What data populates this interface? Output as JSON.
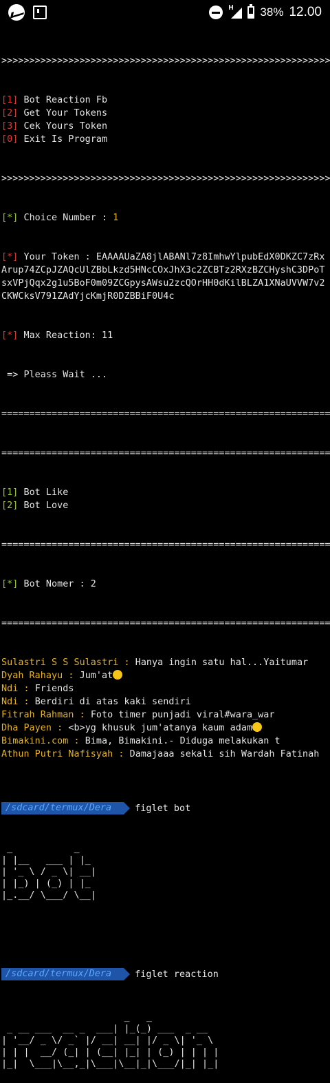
{
  "status_bar": {
    "battery": "38%",
    "time": "12.00",
    "icons": [
      "messenger-icon",
      "flipboard-icon",
      "do-not-disturb-icon",
      "signal-h-icon",
      "battery-icon"
    ]
  },
  "terminal": {
    "sep_arrows": ">>>>>>>>>>>>>>>>>>>>>>>>>>>>>>>>>>>>>>>>>>>>>>>>>>>>>>>>>>>>>>>>>>>>>>>>>>>>>>>>>>>>>",
    "sep_equals": "========================================================================================",
    "menu": [
      {
        "num": "[1]",
        "label": " Bot Reaction Fb"
      },
      {
        "num": "[2]",
        "label": " Get Your Tokens"
      },
      {
        "num": "[3]",
        "label": " Cek Yours Token"
      },
      {
        "num": "[0]",
        "label": " Exit Is Program"
      }
    ],
    "choice": {
      "tag": "[*]",
      "label": " Choice Number : ",
      "value": "1"
    },
    "token": {
      "tag": "[*]",
      "label": " Your Token : ",
      "value": "EAAAAUaZA8jlABANl7z8ImhwYlpubEdX0DKZC7zRxArup74ZCpJZAQcUlZBbLkzd5HNcCOxJhX3c2ZCBTz2RXzBZCHyshC3DPoTsxVPjQqx2g1u5BoF0m09ZCGpysAWsu2zcQOrHH0dKilBLZA1XNaUVVW7v2CKWCksV791ZAdYjcKmjR0DZBBiF0U4c"
    },
    "max_reaction": {
      "tag": "[*]",
      "label": " Max Reaction: 11"
    },
    "wait": " => Pleass Wait ...",
    "bot_options": [
      {
        "num": "[1]",
        "label": " Bot Like"
      },
      {
        "num": "[2]",
        "label": " Bot Love"
      }
    ],
    "bot_nomer": {
      "tag": "[*]",
      "label": " Bot Nomer : 2"
    },
    "feed": [
      {
        "name": "Sulastri S S Sulastri",
        "sep": " : ",
        "text": "Hanya ingin satu hal...Yaitumar",
        "emoji": false
      },
      {
        "name": "Dyah Rahayu",
        "sep": " : ",
        "text": "Jum'at",
        "emoji": true
      },
      {
        "name": "Ndi",
        "sep": " : ",
        "text": "Friends",
        "emoji": false
      },
      {
        "name": "Ndi",
        "sep": " : ",
        "text": "Berdiri di atas kaki sendiri",
        "emoji": false
      },
      {
        "name": "Fitrah Rahman",
        "sep": " : ",
        "text": "Foto timer punjadi viral#wara_war",
        "emoji": false
      },
      {
        "name": "Dha Payen",
        "sep": " : ",
        "text": "<b>yg khusuk jum'atanya kaum adam",
        "emoji": true
      },
      {
        "name": "Bimakini.com",
        "sep": " : ",
        "text": "Bima, Bimakini.- Diduga melakukan t",
        "emoji": false
      },
      {
        "name": "Athun Putri Nafisyah",
        "sep": " : ",
        "text": "Damajaaa sekali sih Wardah Fatinah",
        "emoji": false
      }
    ],
    "prompt_path": "/sdcard/termux/Dera",
    "cmd1": "figlet bot",
    "art_bot": " _           _   \n| |__   ___ | |_ \n| '_ \\ / _ \\| __|\n| |_) | (_) | |_ \n|_.__/ \\___/ \\__|",
    "cmd2": "figlet reaction",
    "art_reaction": "                      _   _             \n _ __ ___  __ _  ___| |_(_) ___  _ __  \n| '__/ _ \\/ _` |/ __| __| |/ _ \\| '_ \\ \n| | |  __/ (_| | (__| |_| | (_) | | | |\n|_|  \\___|\\__,_|\\___|\\__|_|\\___/|_| |_|"
  }
}
